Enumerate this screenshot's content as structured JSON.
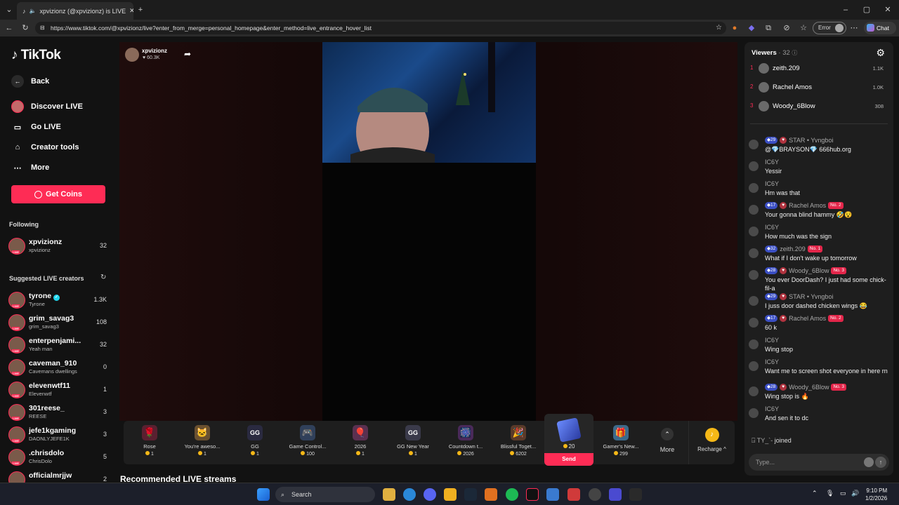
{
  "browser": {
    "tab_title": "xpvizionz (@xpvizionz) is LIVE",
    "url": "https://www.tiktok.com/@xpvizionz/live?enter_from_merge=personal_homepage&enter_method=live_entrance_hover_list",
    "error_label": "Error",
    "chat_label": "Chat"
  },
  "sidebar": {
    "logo": "TikTok",
    "back": "Back",
    "nav": [
      {
        "label": "Discover LIVE",
        "icon": "discover-icon"
      },
      {
        "label": "Go LIVE",
        "icon": "video-camera-icon"
      },
      {
        "label": "Creator tools",
        "icon": "home-icon"
      },
      {
        "label": "More",
        "icon": "more-icon"
      }
    ],
    "get_coins": "Get Coins",
    "following_header": "Following",
    "following": [
      {
        "name": "xpvizionz",
        "sub": "xpvizionz",
        "count": "32"
      }
    ],
    "suggested_header": "Suggested LIVE creators",
    "suggested": [
      {
        "name": "tyrone",
        "sub": "Tyrone",
        "count": "1.3K",
        "verified": true
      },
      {
        "name": "grim_savag3",
        "sub": "grim_savag3",
        "count": "108"
      },
      {
        "name": "enterpenjami...",
        "sub": "Yeah man",
        "count": "32"
      },
      {
        "name": "caveman_910",
        "sub": "Cavemans dwellings",
        "count": "0"
      },
      {
        "name": "elevenwtf11",
        "sub": "Elevenwtf",
        "count": "1"
      },
      {
        "name": "301reese_",
        "sub": "REESE",
        "count": "3"
      },
      {
        "name": "jefe1kgaming",
        "sub": "DAONLYJEFE1K",
        "count": "3"
      },
      {
        "name": ".chrisdolo",
        "sub": "ChrisDolo",
        "count": "5"
      },
      {
        "name": "officialmrjjw",
        "sub": "",
        "count": "2"
      }
    ]
  },
  "stream": {
    "streamer": "xpvizionz",
    "likes": "60.3K",
    "recommended": "Recommended LIVE streams"
  },
  "gifts": [
    {
      "name": "Rose",
      "price": "1",
      "glyph": "🌹"
    },
    {
      "name": "You're aweso...",
      "price": "1",
      "glyph": "🐱"
    },
    {
      "name": "GG",
      "price": "1",
      "glyph": "GG"
    },
    {
      "name": "Game Control...",
      "price": "100",
      "glyph": "🎮"
    },
    {
      "name": "2026",
      "price": "1",
      "glyph": "🎈"
    },
    {
      "name": "GG New Year",
      "price": "1",
      "glyph": "GG"
    },
    {
      "name": "Countdown t...",
      "price": "2026",
      "glyph": "🎆"
    },
    {
      "name": "Blissful Toget...",
      "price": "6202",
      "glyph": "🎉"
    }
  ],
  "featured_gift": {
    "price": "20",
    "send": "Send"
  },
  "gift_after": {
    "name": "Gamer's New...",
    "price": "299",
    "glyph": "🎁"
  },
  "gift_more": "More",
  "recharge": "Recharge",
  "chat": {
    "viewers_label": "Viewers",
    "viewers_count": "32",
    "top_viewers": [
      {
        "rank": "1",
        "name": "zeith.209",
        "score": "1.1K"
      },
      {
        "rank": "2",
        "name": "Rachel Amos",
        "score": "1.0K"
      },
      {
        "rank": "3",
        "name": "Woody_6Blow",
        "score": "308"
      }
    ],
    "messages": [
      {
        "user": "STAR • Yvngboi",
        "level": "29",
        "fan": true,
        "rank": "",
        "text": "@💎BRAYSON💎 666hub.org"
      },
      {
        "user": "IC6Y",
        "level": "",
        "fan": false,
        "rank": "",
        "text": "Yessir"
      },
      {
        "user": "IC6Y",
        "level": "",
        "fan": false,
        "rank": "",
        "text": "Hm was that"
      },
      {
        "user": "Rachel Amos",
        "level": "17",
        "fan": true,
        "rank": "No. 2",
        "text": "Your gonna blind hammy 🤣😵"
      },
      {
        "user": "IC6Y",
        "level": "",
        "fan": false,
        "rank": "",
        "text": "How much was the sign"
      },
      {
        "user": "zeith.209",
        "level": "32",
        "fan": false,
        "rank": "No. 1",
        "text": "What if I don't wake up tomorrow"
      },
      {
        "user": "Woody_6Blow",
        "level": "28",
        "fan": true,
        "rank": "No. 3",
        "text": "You ever DoorDash? I just had some chick-fil-a"
      },
      {
        "user": "STAR • Yvngboi",
        "level": "29",
        "fan": true,
        "rank": "",
        "text": "I juss door dashed chicken wings 😂"
      },
      {
        "user": "Rachel Amos",
        "level": "17",
        "fan": true,
        "rank": "No. 2",
        "text": "60 k"
      },
      {
        "user": "IC6Y",
        "level": "",
        "fan": false,
        "rank": "",
        "text": "Wing stop"
      },
      {
        "user": "IC6Y",
        "level": "",
        "fan": false,
        "rank": "",
        "text": "Want me to screen shot everyone in here rn"
      },
      {
        "user": "Woody_6Blow",
        "level": "28",
        "fan": true,
        "rank": "No. 3",
        "text": "Wing stop is 🔥"
      },
      {
        "user": "IC6Y",
        "level": "",
        "fan": false,
        "rank": "",
        "text": "And sen it to dc"
      }
    ],
    "joined_user": "TY_`-",
    "joined_text": "joined",
    "input_placeholder": "Type..."
  },
  "taskbar": {
    "search": "Search",
    "time": "9:10 PM",
    "date": "1/2/2026"
  },
  "colors": {
    "accent": "#fe2c55",
    "panel": "#1e1e1e",
    "background": "#121212"
  }
}
